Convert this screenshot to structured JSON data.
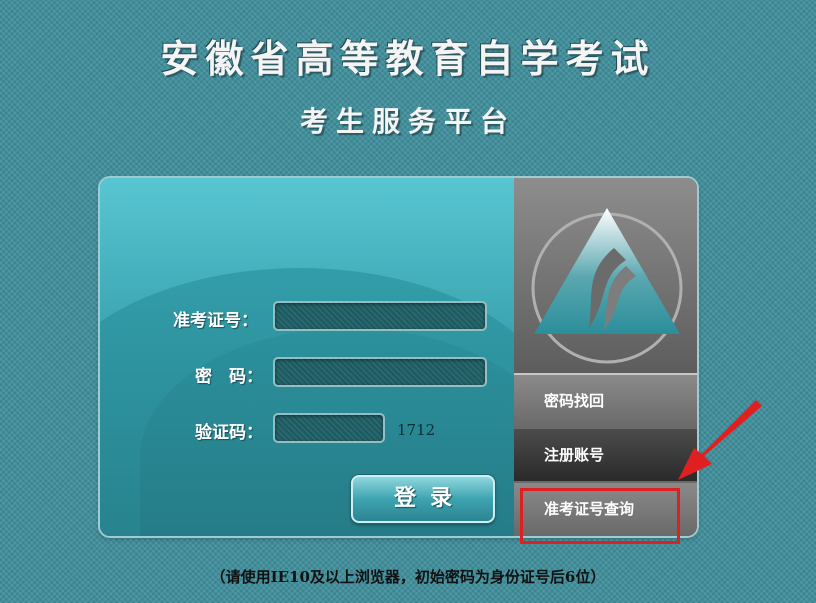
{
  "header": {
    "title": "安徽省高等教育自学考试",
    "subtitle": "考生服务平台"
  },
  "form": {
    "exam_id_label": "准考证号：",
    "exam_id_value": "",
    "password_label": "密　码：",
    "password_value": "",
    "captcha_label": "验证码：",
    "captcha_value": "",
    "captcha_code": "1712",
    "login_label": "登录"
  },
  "sidebar": {
    "items": [
      {
        "label": "密码找回"
      },
      {
        "label": "注册账号"
      },
      {
        "label": "准考证号查询"
      }
    ]
  },
  "footer": {
    "note": "（请使用IE10及以上浏览器，初始密码为身份证号后6位）"
  },
  "colors": {
    "background": "#3f8f9c",
    "highlight": "#e02020"
  },
  "icons": [
    "triangle-logo-icon",
    "annotation-arrow-icon"
  ]
}
